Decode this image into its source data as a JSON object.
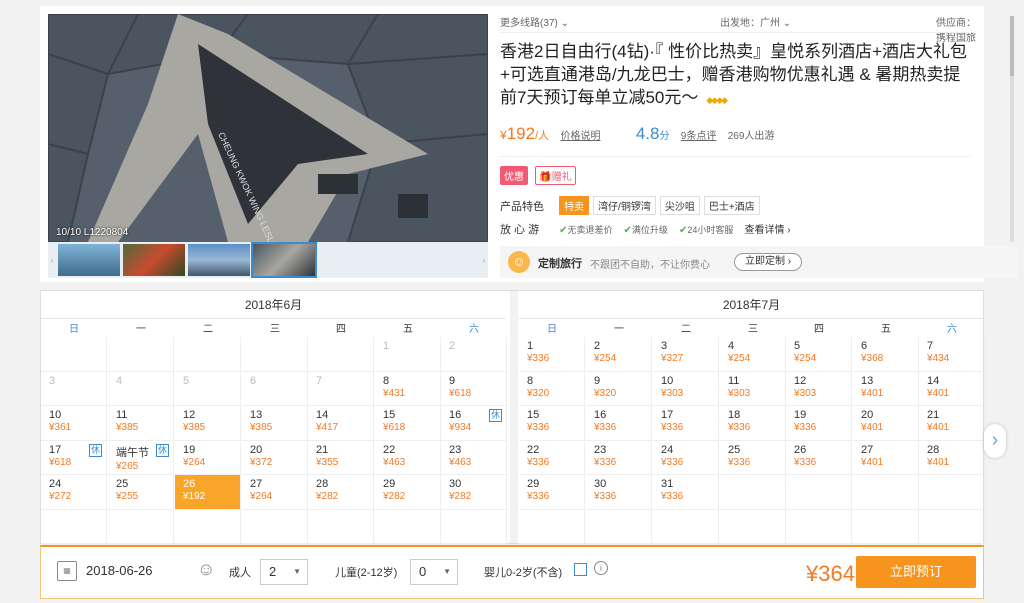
{
  "header": {
    "more_routes": "更多线路(37)",
    "departure": "出发地：广州",
    "supplier": "供应商：携程国旅"
  },
  "gallery": {
    "photo_caption": "10/10 L1220804",
    "thumb_prev": "‹",
    "thumb_next": "›"
  },
  "product": {
    "title": "香港2日自由行(4钻)·『 性价比热卖』皇悦系列酒店+酒店大礼包+可选直通港岛/九龙巴士，赠香港购物优惠礼遇 & 暑期热卖提前7天预订每单立减50元～",
    "diamonds": "◆◆◆◆",
    "price_symbol": "¥",
    "price": "192",
    "price_unit": "/人",
    "price_note": "价格说明",
    "rating": "4.8",
    "rating_unit": "分",
    "reviews": "9条点评",
    "travelled": "269人出游"
  },
  "promo": {
    "tag_discount": "优惠",
    "tag_gift": "赠礼"
  },
  "features": {
    "label": "产品特色",
    "items": [
      "特卖",
      "湾仔/铜锣湾",
      "尖沙咀",
      "巴士+酒店"
    ]
  },
  "assurance": {
    "label": "放 心 游",
    "items": [
      "无卖退差价",
      "满位升级",
      "24小时客服"
    ],
    "view_detail": "查看详情"
  },
  "custom_trip": {
    "title": "定制旅行",
    "desc": "不跟团不自助，不让你费心",
    "button": "立即定制"
  },
  "calendar": {
    "weekdays": [
      "日",
      "一",
      "二",
      "三",
      "四",
      "五",
      "六"
    ],
    "months": [
      {
        "title": "2018年6月",
        "cells": [
          {
            "day": "",
            "price": ""
          },
          {
            "day": "",
            "price": ""
          },
          {
            "day": "",
            "price": ""
          },
          {
            "day": "",
            "price": ""
          },
          {
            "day": "",
            "price": ""
          },
          {
            "day": "1",
            "price": "",
            "gray": true
          },
          {
            "day": "2",
            "price": "",
            "gray": true
          },
          {
            "day": "3",
            "price": "",
            "gray": true
          },
          {
            "day": "4",
            "price": "",
            "gray": true
          },
          {
            "day": "5",
            "price": "",
            "gray": true
          },
          {
            "day": "6",
            "price": "",
            "gray": true
          },
          {
            "day": "7",
            "price": "",
            "gray": true
          },
          {
            "day": "8",
            "price": "¥431"
          },
          {
            "day": "9",
            "price": "¥618"
          },
          {
            "day": "10",
            "price": "¥361"
          },
          {
            "day": "11",
            "price": "¥385"
          },
          {
            "day": "12",
            "price": "¥385"
          },
          {
            "day": "13",
            "price": "¥385"
          },
          {
            "day": "14",
            "price": "¥417"
          },
          {
            "day": "15",
            "price": "¥618"
          },
          {
            "day": "16",
            "price": "¥934",
            "holiday": "休"
          },
          {
            "day": "17",
            "price": "¥618",
            "holiday": "休"
          },
          {
            "day": "端午节",
            "price": "¥265",
            "holiday": "休"
          },
          {
            "day": "19",
            "price": "¥264"
          },
          {
            "day": "20",
            "price": "¥372"
          },
          {
            "day": "21",
            "price": "¥355"
          },
          {
            "day": "22",
            "price": "¥463"
          },
          {
            "day": "23",
            "price": "¥463"
          },
          {
            "day": "24",
            "price": "¥272"
          },
          {
            "day": "25",
            "price": "¥255"
          },
          {
            "day": "26",
            "price": "¥192",
            "selected": true
          },
          {
            "day": "27",
            "price": "¥264"
          },
          {
            "day": "28",
            "price": "¥282"
          },
          {
            "day": "29",
            "price": "¥282"
          },
          {
            "day": "30",
            "price": "¥282"
          },
          {
            "day": "",
            "price": ""
          },
          {
            "day": "",
            "price": ""
          },
          {
            "day": "",
            "price": ""
          },
          {
            "day": "",
            "price": ""
          },
          {
            "day": "",
            "price": ""
          },
          {
            "day": "",
            "price": ""
          },
          {
            "day": "",
            "price": ""
          }
        ]
      },
      {
        "title": "2018年7月",
        "cells": [
          {
            "day": "1",
            "price": "¥336"
          },
          {
            "day": "2",
            "price": "¥254"
          },
          {
            "day": "3",
            "price": "¥327"
          },
          {
            "day": "4",
            "price": "¥254"
          },
          {
            "day": "5",
            "price": "¥254"
          },
          {
            "day": "6",
            "price": "¥368"
          },
          {
            "day": "7",
            "price": "¥434"
          },
          {
            "day": "8",
            "price": "¥320"
          },
          {
            "day": "9",
            "price": "¥320"
          },
          {
            "day": "10",
            "price": "¥303"
          },
          {
            "day": "11",
            "price": "¥303"
          },
          {
            "day": "12",
            "price": "¥303"
          },
          {
            "day": "13",
            "price": "¥401"
          },
          {
            "day": "14",
            "price": "¥401"
          },
          {
            "day": "15",
            "price": "¥336"
          },
          {
            "day": "16",
            "price": "¥336"
          },
          {
            "day": "17",
            "price": "¥336"
          },
          {
            "day": "18",
            "price": "¥336"
          },
          {
            "day": "19",
            "price": "¥336"
          },
          {
            "day": "20",
            "price": "¥401"
          },
          {
            "day": "21",
            "price": "¥401"
          },
          {
            "day": "22",
            "price": "¥336"
          },
          {
            "day": "23",
            "price": "¥336"
          },
          {
            "day": "24",
            "price": "¥336"
          },
          {
            "day": "25",
            "price": "¥336"
          },
          {
            "day": "26",
            "price": "¥336"
          },
          {
            "day": "27",
            "price": "¥401"
          },
          {
            "day": "28",
            "price": "¥401"
          },
          {
            "day": "29",
            "price": "¥336"
          },
          {
            "day": "30",
            "price": "¥336"
          },
          {
            "day": "31",
            "price": "¥336"
          },
          {
            "day": "",
            "price": ""
          },
          {
            "day": "",
            "price": ""
          },
          {
            "day": "",
            "price": ""
          },
          {
            "day": "",
            "price": ""
          },
          {
            "day": "",
            "price": ""
          },
          {
            "day": "",
            "price": ""
          },
          {
            "day": "",
            "price": ""
          },
          {
            "day": "",
            "price": ""
          },
          {
            "day": "",
            "price": ""
          },
          {
            "day": "",
            "price": ""
          },
          {
            "day": "",
            "price": ""
          }
        ]
      }
    ]
  },
  "booking": {
    "date": "2018-06-26",
    "adult_label": "成人",
    "adult_value": "2",
    "child_label": "儿童(2-12岁)",
    "child_value": "0",
    "infant_label": "婴儿0-2岁(不含)",
    "total_price": "¥364",
    "book_button": "立即预订"
  },
  "colors": {
    "accent_orange": "#f7941d",
    "price_orange": "#f37a22",
    "link_blue": "#3b8ccf"
  }
}
